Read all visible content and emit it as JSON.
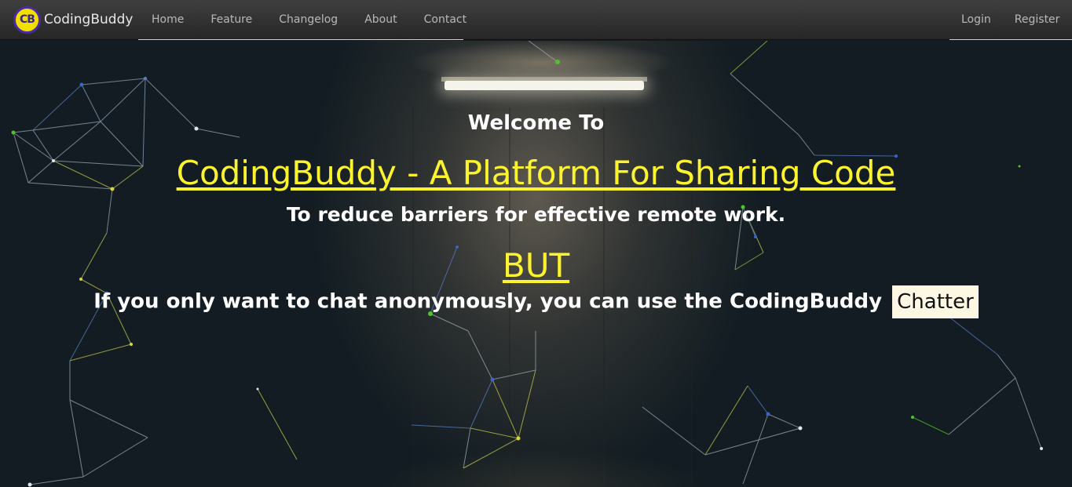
{
  "brand": {
    "logo_text": "CB",
    "name": "CodingBuddy"
  },
  "nav": {
    "links": [
      "Home",
      "Feature",
      "Changelog",
      "About",
      "Contact"
    ],
    "right": [
      "Login",
      "Register"
    ]
  },
  "hero": {
    "welcome": "Welcome To",
    "headline": "CodingBuddy - A Platform For Sharing Code",
    "subtitle": "To reduce barriers for effective remote work.",
    "but": "BUT",
    "chat_text": "If you only want to chat anonymously, you can use the CodingBuddy",
    "chatter_label": "Chatter"
  },
  "colors": {
    "accent": "#fbf32e",
    "background": "#121c22",
    "navbar": "#333333",
    "button_bg": "#fdf8e4"
  }
}
